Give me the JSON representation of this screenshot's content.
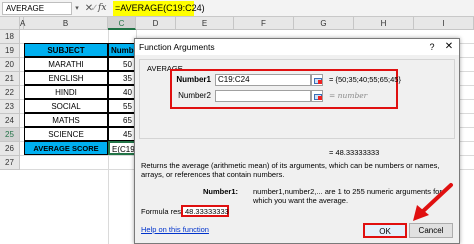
{
  "formula_bar": {
    "name_box": "AVERAGE",
    "cancel_glyph": "✕",
    "enter_glyph": "✓",
    "fx_label": "fx",
    "formula": "=AVERAGE(C19:C24)"
  },
  "columns": [
    "A",
    "B",
    "C",
    "D",
    "E",
    "F",
    "G",
    "H",
    "I"
  ],
  "rows": [
    "18",
    "19",
    "20",
    "21",
    "22",
    "23",
    "24",
    "25",
    "26",
    "27"
  ],
  "table": {
    "header": {
      "subject": "SUBJECT",
      "number": "Numb"
    },
    "rows": [
      {
        "subject": "MARATHI",
        "value": "50"
      },
      {
        "subject": "ENGLISH",
        "value": "35"
      },
      {
        "subject": "HINDI",
        "value": "40"
      },
      {
        "subject": "SOCIAL",
        "value": "55"
      },
      {
        "subject": "MATHS",
        "value": "65"
      },
      {
        "subject": "SCIENCE",
        "value": "45"
      }
    ],
    "avg_label": "AVERAGE SCORE",
    "avg_cell": "E(C19:C24)"
  },
  "dialog": {
    "title": "Function Arguments",
    "help_glyph": "?",
    "close_glyph": "✕",
    "function_name": "AVERAGE",
    "arg1_label": "Number1",
    "arg1_value": "C19:C24",
    "arg1_result": "= {50;35;40;55;65;45}",
    "arg2_label": "Number2",
    "arg2_value": "",
    "arg2_result": "= number",
    "total_result": "= 48.33333333",
    "description": "Returns the average (arithmetic mean) of its arguments, which can be numbers or names, arrays, or references that contain numbers.",
    "arg_help_label": "Number1:",
    "arg_help_text": "number1,number2,... are 1 to 255 numeric arguments for which you want the average.",
    "formula_result_label": "Formula result =",
    "formula_result_value": "48.33333333",
    "help_link": "Help on this function",
    "ok_label": "OK",
    "cancel_label": "Cancel"
  },
  "colors": {
    "header_fill": "#00b0f0",
    "formula_highlight": "#ffff00",
    "highlight_red": "#e01010",
    "selection_green": "#217346"
  }
}
